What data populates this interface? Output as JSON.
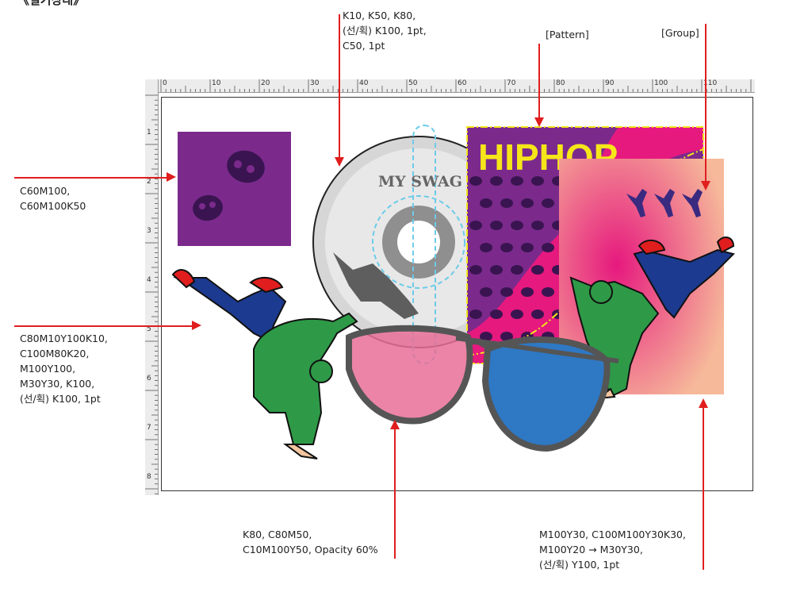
{
  "header_fragment": "《실기상태》",
  "annotations": {
    "disc": "K10, K50, K80,\n(선/획) K100, 1pt,\nC50, 1pt",
    "pattern": "[Pattern]",
    "group": "[Group]",
    "skull_box": "C60M100,\nC60M100K50",
    "dancer": "C80M10Y100K10,\nC100M80K20,\nM100Y100,\nM30Y30, K100,\n(선/획) K100, 1pt",
    "glasses": "K80, C80M50,\nC10M100Y50, Opacity 60%",
    "gradient": "M100Y30, C100M100Y30K30,\nM100Y20 → M30Y30,\n(선/획) Y100, 1pt"
  },
  "artwork": {
    "cd_text": "MY SWAG",
    "hiphop_text": "HIPHOP"
  },
  "ruler": {
    "horizontal_labels": [
      "0",
      "10",
      "20",
      "30",
      "40",
      "50",
      "60",
      "70",
      "80",
      "90",
      "100",
      "110"
    ],
    "vertical_labels": [
      "1",
      "2",
      "3",
      "4",
      "5",
      "6",
      "7",
      "8"
    ]
  },
  "colors": {
    "annotation_line": "#e01e1e",
    "purple": "#7b2a8c",
    "dark_purple": "#3a1450",
    "magenta": "#e6197e",
    "peach": "#f6b99a",
    "yellow": "#f5e61a",
    "green": "#2e9a47",
    "navy": "#1c3a8f",
    "pink_lens": "#e86f97",
    "blue_lens": "#2e78c4",
    "frame_gray": "#555555",
    "cyan_guide": "#6ccbe8"
  }
}
